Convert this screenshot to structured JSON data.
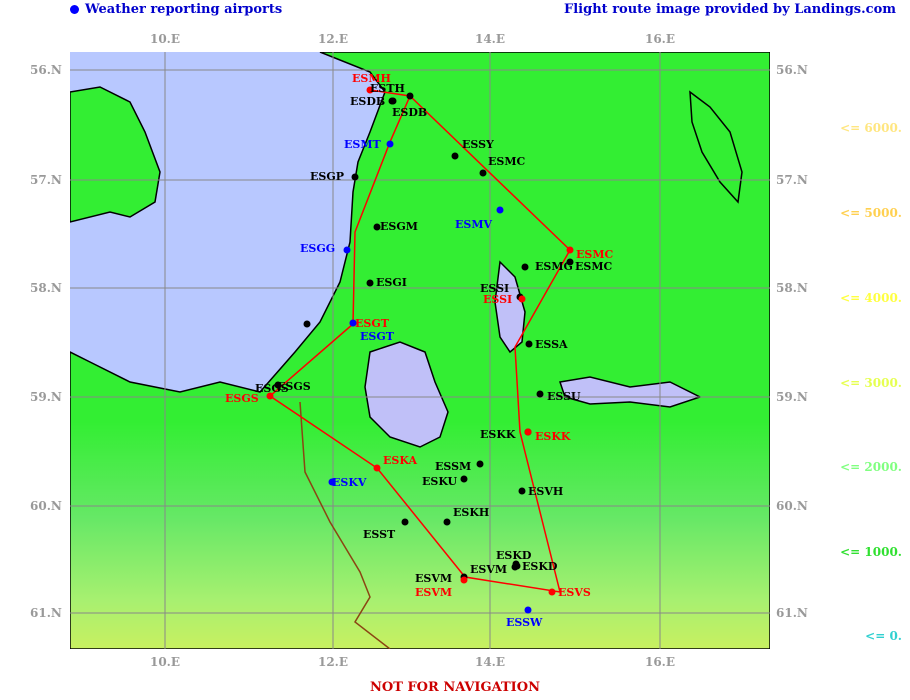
{
  "header": {
    "left": "Weather reporting airports",
    "right": "Flight route image provided by Landings.com"
  },
  "footer": "NOT FOR NAVIGATION",
  "longitude_labels": [
    "10.E",
    "12.E",
    "14.E",
    "16.E"
  ],
  "latitude_labels": [
    "56.N",
    "57.N",
    "58.N",
    "59.N",
    "60.N",
    "61.N"
  ],
  "legend": [
    {
      "label": "<= 6000.",
      "color": "#ffe680"
    },
    {
      "label": "<= 5000.",
      "color": "#ffd050"
    },
    {
      "label": "<= 4000.",
      "color": "#ffff40"
    },
    {
      "label": "<= 3000.",
      "color": "#e6ff50"
    },
    {
      "label": "<= 2000.",
      "color": "#80ff80"
    },
    {
      "label": "<= 1000.",
      "color": "#30e030"
    },
    {
      "label": "<= 0.",
      "color": "#30d0d0"
    }
  ],
  "colors": {
    "water": "#b8c8ff",
    "lake": "#c0c0f8",
    "land": "#33ee33",
    "route": "#ff0000",
    "reporting_airport": "#0000ff",
    "airport": "#000000"
  },
  "airports": [
    {
      "code": "ESMH",
      "color": "red"
    },
    {
      "code": "ESTH",
      "color": "black"
    },
    {
      "code": "ESDB",
      "color": "black"
    },
    {
      "code": "ESDB",
      "color": "black"
    },
    {
      "code": "ESMT",
      "color": "blue"
    },
    {
      "code": "ESSY",
      "color": "black"
    },
    {
      "code": "ESMC",
      "color": "black"
    },
    {
      "code": "ESGP",
      "color": "black"
    },
    {
      "code": "ESMV",
      "color": "blue"
    },
    {
      "code": "ESGM",
      "color": "black"
    },
    {
      "code": "ESGG",
      "color": "blue"
    },
    {
      "code": "ESMC",
      "color": "red"
    },
    {
      "code": "ESMG",
      "color": "black"
    },
    {
      "code": "ESMC",
      "color": "black"
    },
    {
      "code": "ESGI",
      "color": "black"
    },
    {
      "code": "ESSI",
      "color": "black"
    },
    {
      "code": "ESSI",
      "color": "red"
    },
    {
      "code": "ESGT",
      "color": "red"
    },
    {
      "code": "ESGT",
      "color": "blue"
    },
    {
      "code": "ESSA",
      "color": "black"
    },
    {
      "code": "ESGS",
      "color": "black"
    },
    {
      "code": "ESGS",
      "color": "black"
    },
    {
      "code": "ESGS",
      "color": "red"
    },
    {
      "code": "ESSU",
      "color": "black"
    },
    {
      "code": "ESKK",
      "color": "black"
    },
    {
      "code": "ESKK",
      "color": "red"
    },
    {
      "code": "ESKA",
      "color": "red"
    },
    {
      "code": "ESSM",
      "color": "black"
    },
    {
      "code": "ESKU",
      "color": "black"
    },
    {
      "code": "ESKV",
      "color": "blue"
    },
    {
      "code": "ESVH",
      "color": "black"
    },
    {
      "code": "ESKH",
      "color": "black"
    },
    {
      "code": "ESST",
      "color": "black"
    },
    {
      "code": "ESKD",
      "color": "black"
    },
    {
      "code": "ESVM",
      "color": "black"
    },
    {
      "code": "ESKD",
      "color": "black"
    },
    {
      "code": "ESVM",
      "color": "black"
    },
    {
      "code": "ESVM",
      "color": "red"
    },
    {
      "code": "ESVS",
      "color": "red"
    },
    {
      "code": "ESSW",
      "color": "blue"
    }
  ]
}
